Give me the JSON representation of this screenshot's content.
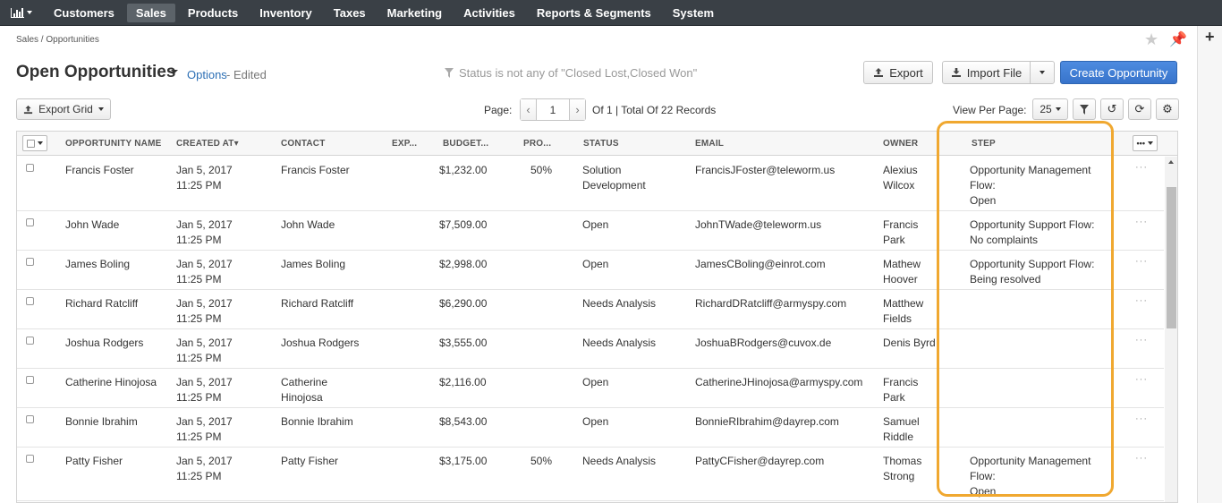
{
  "nav": {
    "items": [
      "Customers",
      "Sales",
      "Products",
      "Inventory",
      "Taxes",
      "Marketing",
      "Activities",
      "Reports & Segments",
      "System"
    ],
    "active": "Sales"
  },
  "breadcrumb": "Sales / Opportunities",
  "title": "Open Opportunities",
  "options_label": "Options",
  "edited_label": "- Edited",
  "filter_note": "Status is not any of \"Closed Lost,Closed Won\"",
  "buttons": {
    "export": "Export",
    "import": "Import File",
    "create": "Create Opportunity",
    "export_grid": "Export Grid"
  },
  "pager": {
    "label": "Page:",
    "current": "1",
    "summary": "Of 1 | Total Of 22 Records",
    "view_per_page_label": "View Per Page:",
    "view_per_page": "25"
  },
  "columns": [
    "OPPORTUNITY NAME",
    "CREATED AT▾",
    "CONTACT",
    "EXP...",
    "BUDGET...",
    "PRO...",
    "STATUS",
    "EMAIL",
    "OWNER",
    "STEP"
  ],
  "rows": [
    {
      "name": "Francis Foster",
      "created": [
        "Jan 5, 2017",
        "11:25 PM"
      ],
      "contact": [
        "Francis Foster"
      ],
      "budget": "$1,232.00",
      "prob": "50%",
      "status": [
        "Solution",
        "Development"
      ],
      "email": "FrancisJFoster@teleworm.us",
      "owner": [
        "Alexius",
        "Wilcox"
      ],
      "step": [
        "Opportunity Management",
        "Flow:",
        "Open"
      ]
    },
    {
      "name": "John Wade",
      "created": [
        "Jan 5, 2017",
        "11:25 PM"
      ],
      "contact": [
        "John Wade"
      ],
      "budget": "$7,509.00",
      "prob": "",
      "status": [
        "Open"
      ],
      "email": "JohnTWade@teleworm.us",
      "owner": [
        "Francis",
        "Park"
      ],
      "step": [
        "Opportunity Support Flow:",
        "No complaints"
      ]
    },
    {
      "name": "James Boling",
      "created": [
        "Jan 5, 2017",
        "11:25 PM"
      ],
      "contact": [
        "James Boling"
      ],
      "budget": "$2,998.00",
      "prob": "",
      "status": [
        "Open"
      ],
      "email": "JamesCBoling@einrot.com",
      "owner": [
        "Mathew",
        "Hoover"
      ],
      "step": [
        "Opportunity Support Flow:",
        "Being resolved"
      ]
    },
    {
      "name": "Richard Ratcliff",
      "created": [
        "Jan 5, 2017",
        "11:25 PM"
      ],
      "contact": [
        "Richard Ratcliff"
      ],
      "budget": "$6,290.00",
      "prob": "",
      "status": [
        "Needs Analysis"
      ],
      "email": "RichardDRatcliff@armyspy.com",
      "owner": [
        "Matthew",
        "Fields"
      ],
      "step": []
    },
    {
      "name": "Joshua Rodgers",
      "created": [
        "Jan 5, 2017",
        "11:25 PM"
      ],
      "contact": [
        "Joshua Rodgers"
      ],
      "budget": "$3,555.00",
      "prob": "",
      "status": [
        "Needs Analysis"
      ],
      "email": "JoshuaBRodgers@cuvox.de",
      "owner": [
        "Denis Byrd"
      ],
      "step": []
    },
    {
      "name": "Catherine Hinojosa",
      "created": [
        "Jan 5, 2017",
        "11:25 PM"
      ],
      "contact": [
        "Catherine",
        "Hinojosa"
      ],
      "budget": "$2,116.00",
      "prob": "",
      "status": [
        "Open"
      ],
      "email": "CatherineJHinojosa@armyspy.com",
      "owner": [
        "Francis",
        "Park"
      ],
      "step": []
    },
    {
      "name": "Bonnie Ibrahim",
      "created": [
        "Jan 5, 2017",
        "11:25 PM"
      ],
      "contact": [
        "Bonnie Ibrahim"
      ],
      "budget": "$8,543.00",
      "prob": "",
      "status": [
        "Open"
      ],
      "email": "BonnieRIbrahim@dayrep.com",
      "owner": [
        "Samuel",
        "Riddle"
      ],
      "step": []
    },
    {
      "name": "Patty Fisher",
      "created": [
        "Jan 5, 2017",
        "11:25 PM"
      ],
      "contact": [
        "Patty Fisher"
      ],
      "budget": "$3,175.00",
      "prob": "50%",
      "status": [
        "Needs Analysis"
      ],
      "email": "PattyCFisher@dayrep.com",
      "owner": [
        "Thomas",
        "Strong"
      ],
      "step": [
        "Opportunity Management",
        "Flow:",
        "Open"
      ]
    }
  ],
  "colors": {
    "nav_bg": "#3a4046",
    "primary": "#3a7bd5",
    "highlight": "#f0a830",
    "link": "#2c6fb5"
  }
}
